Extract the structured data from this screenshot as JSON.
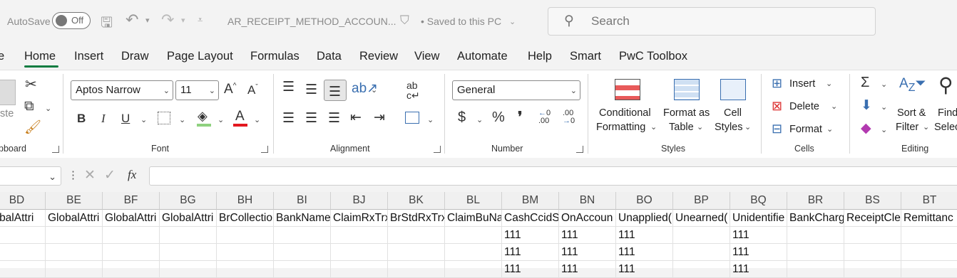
{
  "titlebar": {
    "autosave_label": "AutoSave",
    "autosave_state": "Off",
    "filename": "AR_RECEIPT_METHOD_ACCOUN...",
    "save_status": "• Saved to this PC",
    "search_placeholder": "Search"
  },
  "menu": {
    "items": [
      "e",
      "Home",
      "Insert",
      "Draw",
      "Page Layout",
      "Formulas",
      "Data",
      "Review",
      "View",
      "Automate",
      "Help",
      "Smart",
      "PwC Toolbox"
    ],
    "active": "Home"
  },
  "ribbon": {
    "clipboard": {
      "paste_label": "ste",
      "group": "pboard"
    },
    "font": {
      "name": "Aptos Narrow",
      "size": "11",
      "group": "Font",
      "bold": "B",
      "italic": "I",
      "underline": "U",
      "grow": "A^",
      "shrink": "A˅",
      "font_color": "#e3181f",
      "fill_color": "#8fd17f"
    },
    "alignment": {
      "group": "Alignment"
    },
    "number": {
      "format": "General",
      "group": "Number",
      "currency": "$",
      "percent": "%",
      "comma": "❜",
      "inc_decimal": ".00",
      "dec_decimal": ".00"
    },
    "styles": {
      "group": "Styles",
      "conditional_line1": "Conditional",
      "conditional_line2": "Formatting",
      "format_table_line1": "Format as",
      "format_table_line2": "Table",
      "cell_styles_line1": "Cell",
      "cell_styles_line2": "Styles"
    },
    "cells": {
      "group": "Cells",
      "insert": "Insert",
      "delete": "Delete",
      "format": "Format"
    },
    "editing": {
      "group": "Editing",
      "sort_line1": "Sort &",
      "sort_line2": "Filter",
      "find_line1": "Find",
      "find_line2": "Selec"
    }
  },
  "formula_bar": {
    "fx": "fx",
    "value": ""
  },
  "grid": {
    "columns": [
      {
        "letter": "BD",
        "header": "lobalAttri"
      },
      {
        "letter": "BE",
        "header": "GlobalAttri"
      },
      {
        "letter": "BF",
        "header": "GlobalAttri"
      },
      {
        "letter": "BG",
        "header": "GlobalAttri"
      },
      {
        "letter": "BH",
        "header": "BrCollectio"
      },
      {
        "letter": "BI",
        "header": "BankName"
      },
      {
        "letter": "BJ",
        "header": "ClaimRxTrx"
      },
      {
        "letter": "BK",
        "header": "BrStdRxTrx"
      },
      {
        "letter": "BL",
        "header": "ClaimBuNa"
      },
      {
        "letter": "BM",
        "header": "CashCcidS"
      },
      {
        "letter": "BN",
        "header": "OnAccoun"
      },
      {
        "letter": "BO",
        "header": "Unapplied("
      },
      {
        "letter": "BP",
        "header": "Unearned("
      },
      {
        "letter": "BQ",
        "header": "Unidentifie"
      },
      {
        "letter": "BR",
        "header": "BankCharg"
      },
      {
        "letter": "BS",
        "header": "ReceiptCle"
      },
      {
        "letter": "BT",
        "header": "Remittanc"
      }
    ],
    "rows": [
      [
        "",
        "",
        "",
        "",
        "",
        "",
        "",
        "",
        "",
        "111",
        "111",
        "111",
        "",
        "111",
        "",
        "",
        ""
      ],
      [
        "",
        "",
        "",
        "",
        "",
        "",
        "",
        "",
        "",
        "111",
        "111",
        "111",
        "",
        "111",
        "",
        "",
        ""
      ],
      [
        "",
        "",
        "",
        "",
        "",
        "",
        "",
        "",
        "",
        "111",
        "111",
        "111",
        "",
        "111",
        "",
        "",
        ""
      ]
    ]
  }
}
